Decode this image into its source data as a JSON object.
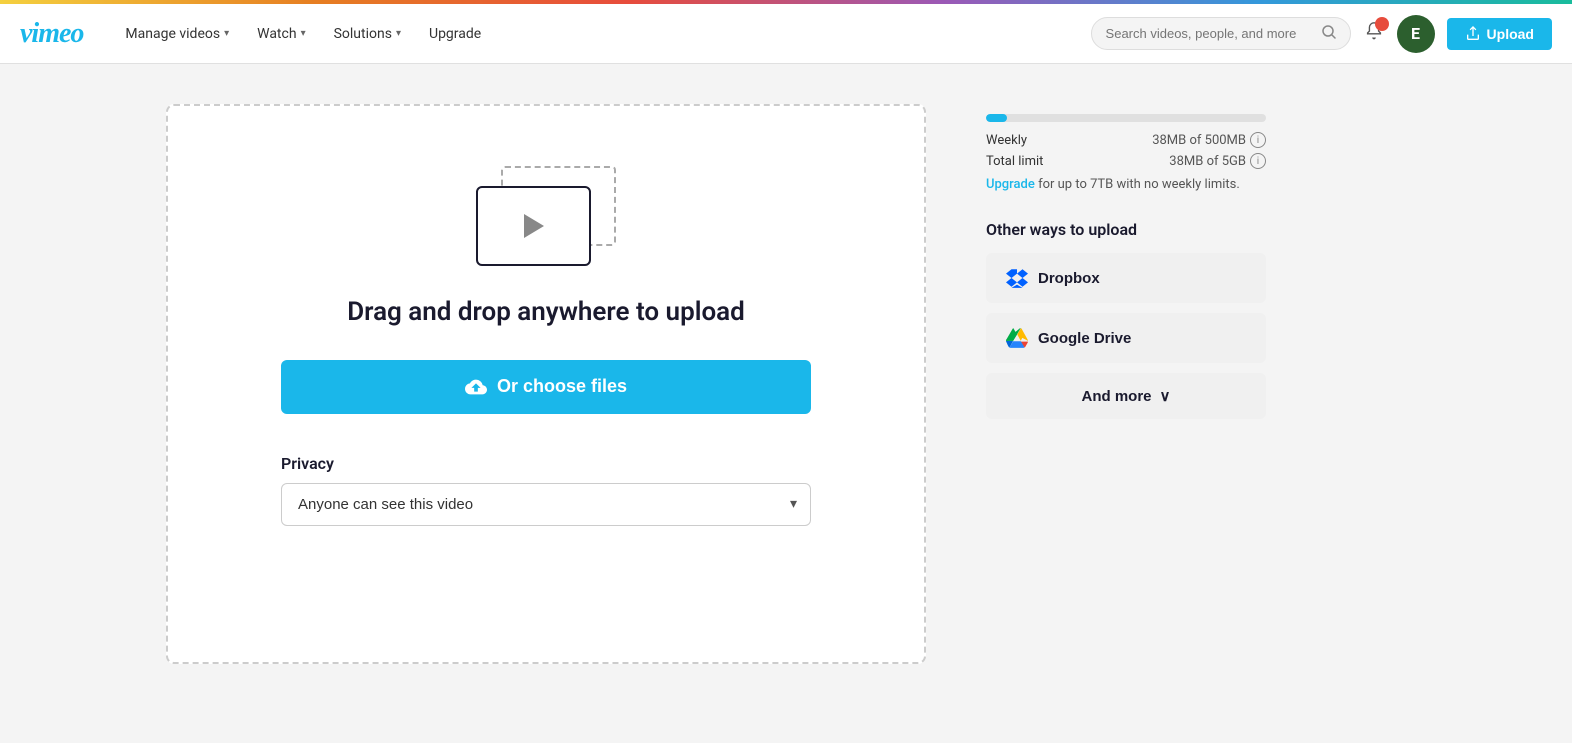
{
  "rainbow_bar": {},
  "header": {
    "logo": "vimeo",
    "nav": [
      {
        "label": "Manage videos",
        "has_arrow": true
      },
      {
        "label": "Watch",
        "has_arrow": true
      },
      {
        "label": "Solutions",
        "has_arrow": true
      },
      {
        "label": "Upgrade",
        "has_arrow": false
      }
    ],
    "search_placeholder": "Search videos, people, and more",
    "bell_badge": "•",
    "avatar_letter": "E",
    "upload_button": "Upload"
  },
  "upload_area": {
    "drag_text": "Drag and drop anywhere to upload",
    "choose_files_label": "Or choose files",
    "privacy_label": "Privacy",
    "privacy_option": "Anyone can see this video"
  },
  "right_panel": {
    "weekly_label": "Weekly",
    "weekly_value": "38MB of 500MB",
    "total_label": "Total limit",
    "total_value": "38MB of 5GB",
    "upgrade_link": "Upgrade",
    "upgrade_suffix": " for up to 7TB with no weekly limits.",
    "storage_percent": 7.6,
    "other_ways_title": "Other ways to upload",
    "dropbox_label": "Dropbox",
    "gdrive_label": "Google Drive",
    "and_more_label": "And more",
    "chevron_down": "∨"
  }
}
